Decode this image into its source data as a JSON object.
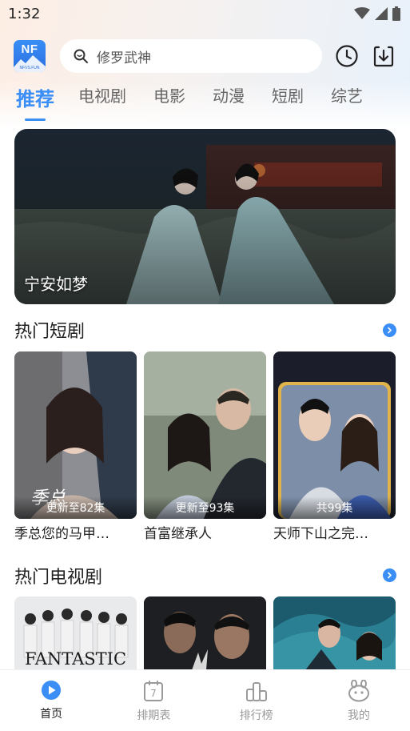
{
  "status": {
    "time": "1:32"
  },
  "header": {
    "logo_text": "NF",
    "logo_sub": "NFVS.FUN",
    "search_placeholder": "修罗武神"
  },
  "tabs": [
    {
      "label": "推荐",
      "active": true
    },
    {
      "label": "电视剧"
    },
    {
      "label": "电影"
    },
    {
      "label": "动漫"
    },
    {
      "label": "短剧"
    },
    {
      "label": "综艺"
    }
  ],
  "banner": {
    "title": "宁安如梦"
  },
  "short_drama": {
    "title": "热门短剧",
    "items": [
      {
        "title": "季总您的马甲…",
        "badge": "更新至82集"
      },
      {
        "title": "首富继承人",
        "badge": "更新至93集"
      },
      {
        "title": "天师下山之完…",
        "badge": "共99集"
      }
    ]
  },
  "tv": {
    "title": "热门电视剧",
    "poster_text": "FANTASTIC"
  },
  "bottom_nav": [
    {
      "label": "首页",
      "active": true
    },
    {
      "label": "排期表"
    },
    {
      "label": "排行榜"
    },
    {
      "label": "我的"
    }
  ],
  "colors": {
    "accent": "#3a8ef6"
  }
}
